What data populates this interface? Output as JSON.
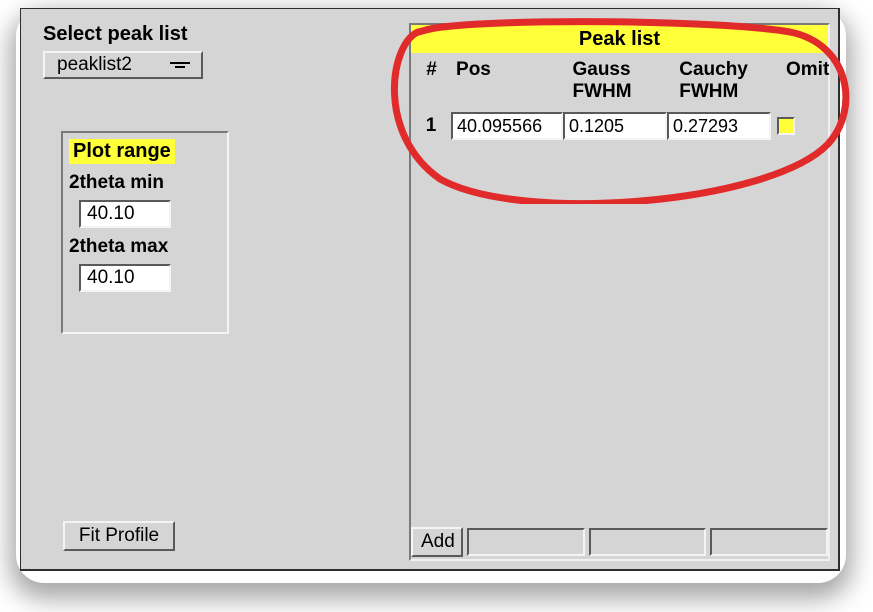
{
  "left": {
    "select_label": "Select peak list",
    "select_value": "peaklist2",
    "plot_range_title": "Plot range",
    "two_theta_min_label": "2theta min",
    "two_theta_min_value": "40.10",
    "two_theta_max_label": "2theta max",
    "two_theta_max_value": "40.10",
    "fit_button": "Fit Profile"
  },
  "peak_panel": {
    "title": "Peak list",
    "headers": {
      "num": "#",
      "pos": "Pos",
      "gauss": "Gauss FWHM",
      "cauchy": "Cauchy FWHM",
      "omit": "Omit"
    },
    "rows": [
      {
        "num": "1",
        "pos": "40.095566",
        "gauss": "0.1205",
        "cauchy": "0.27293",
        "omit": false
      }
    ],
    "add_button": "Add"
  }
}
